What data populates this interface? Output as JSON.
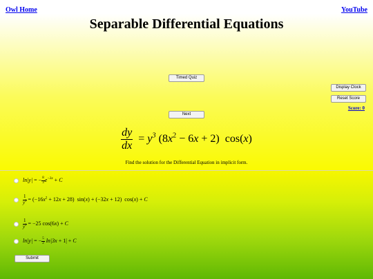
{
  "nav": {
    "home": "Owl Home",
    "youtube": "YouTube"
  },
  "title": "Separable Differential Equations",
  "buttons": {
    "timed_quiz": "Timed Quiz",
    "next": "Next",
    "display_clock": "Display Clock",
    "reset_score": "Reset Score",
    "submit": "Submit"
  },
  "score": "Score: 0",
  "question": {
    "equation": "dy/dx = y^3 (8x^2 − 6x + 2) cos(x)",
    "instruction": "Find the solution for the Differential Equation in implicit form."
  },
  "options": [
    "ln|y| = −(8/3) e^(−3x) + C",
    "1/y^2 = (−16x^2 + 12x + 28) sin(x) + (−32x + 12) cos(x) + C",
    "1/y^2 = −25 cos(6x) + C",
    "ln|y| = −(5/2) ln|3x + 1| + C"
  ]
}
